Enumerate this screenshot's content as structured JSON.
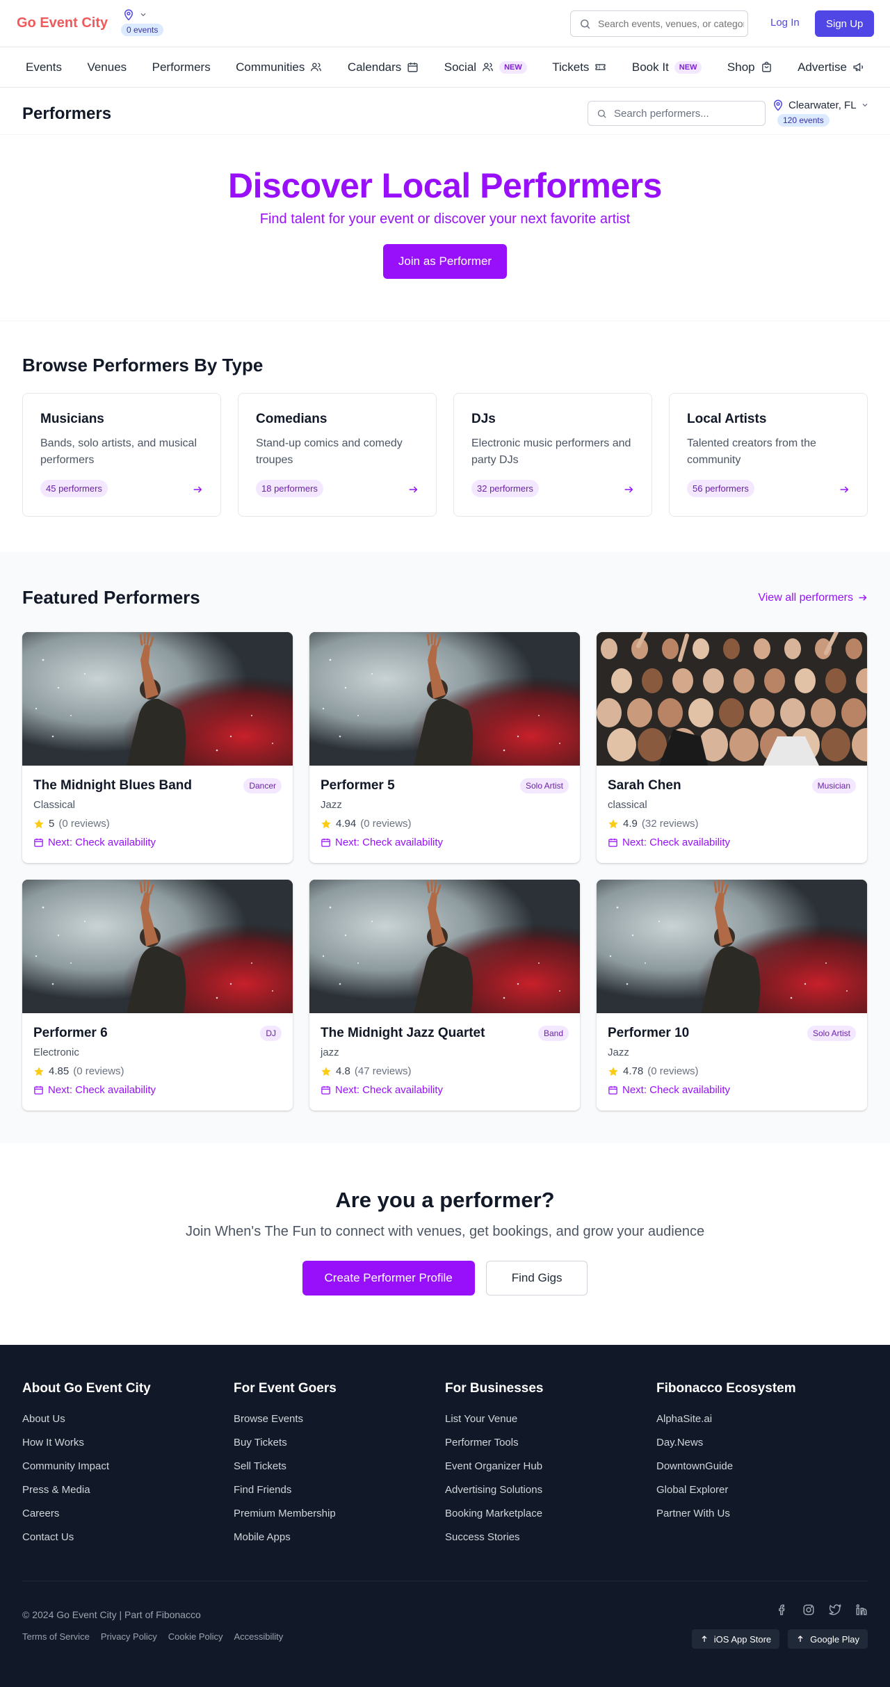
{
  "header": {
    "logo": "Go Event City",
    "location_events": "0 events",
    "search_placeholder": "Search events, venues, or categories...",
    "login": "Log In",
    "signup": "Sign Up"
  },
  "nav": [
    {
      "label": "Events"
    },
    {
      "label": "Venues"
    },
    {
      "label": "Performers"
    },
    {
      "label": "Communities",
      "icon": "users-icon"
    },
    {
      "label": "Calendars",
      "icon": "calendar-icon"
    },
    {
      "label": "Social",
      "icon": "users-icon",
      "badge": "NEW"
    },
    {
      "label": "Tickets",
      "icon": "ticket-icon"
    },
    {
      "label": "Book It",
      "badge": "NEW"
    },
    {
      "label": "Shop",
      "icon": "bag-icon"
    },
    {
      "label": "Advertise",
      "icon": "megaphone-icon"
    }
  ],
  "subheader": {
    "title": "Performers",
    "search_placeholder": "Search performers...",
    "location": "Clearwater, FL",
    "events": "120 events"
  },
  "hero": {
    "title": "Discover Local Performers",
    "subtitle": "Find talent for your event or discover your next favorite artist",
    "button": "Join as Performer"
  },
  "browse": {
    "title": "Browse Performers By Type",
    "types": [
      {
        "name": "Musicians",
        "desc": "Bands, solo artists, and musical performers",
        "count": "45 performers"
      },
      {
        "name": "Comedians",
        "desc": "Stand-up comics and comedy troupes",
        "count": "18 performers"
      },
      {
        "name": "DJs",
        "desc": "Electronic music performers and party DJs",
        "count": "32 performers"
      },
      {
        "name": "Local Artists",
        "desc": "Talented creators from the community",
        "count": "56 performers"
      }
    ]
  },
  "featured": {
    "title": "Featured Performers",
    "view_all": "View all performers",
    "performers": [
      {
        "name": "The Midnight Blues Band",
        "tag": "Dancer",
        "genre": "Classical",
        "rating": "5",
        "reviews": "(0 reviews)",
        "next": "Next: Check availability",
        "image": "concert-smoke"
      },
      {
        "name": "Performer 5",
        "tag": "Solo Artist",
        "genre": "Jazz",
        "rating": "4.94",
        "reviews": "(0 reviews)",
        "next": "Next: Check availability",
        "image": "concert-smoke"
      },
      {
        "name": "Sarah Chen",
        "tag": "Musician",
        "genre": "classical",
        "rating": "4.9",
        "reviews": "(32 reviews)",
        "next": "Next: Check availability",
        "image": "concert-crowd"
      },
      {
        "name": "Performer 6",
        "tag": "DJ",
        "genre": "Electronic",
        "rating": "4.85",
        "reviews": "(0 reviews)",
        "next": "Next: Check availability",
        "image": "concert-smoke"
      },
      {
        "name": "The Midnight Jazz Quartet",
        "tag": "Band",
        "genre": "jazz",
        "rating": "4.8",
        "reviews": "(47 reviews)",
        "next": "Next: Check availability",
        "image": "concert-smoke"
      },
      {
        "name": "Performer 10",
        "tag": "Solo Artist",
        "genre": "Jazz",
        "rating": "4.78",
        "reviews": "(0 reviews)",
        "next": "Next: Check availability",
        "image": "concert-smoke"
      }
    ]
  },
  "cta": {
    "title": "Are you a performer?",
    "subtitle": "Join When's The Fun to connect with venues, get bookings, and grow your audience",
    "primary": "Create Performer Profile",
    "secondary": "Find Gigs"
  },
  "footer": {
    "columns": [
      {
        "title": "About Go Event City",
        "links": [
          "About Us",
          "How It Works",
          "Community Impact",
          "Press & Media",
          "Careers",
          "Contact Us"
        ]
      },
      {
        "title": "For Event Goers",
        "links": [
          "Browse Events",
          "Buy Tickets",
          "Sell Tickets",
          "Find Friends",
          "Premium Membership",
          "Mobile Apps"
        ]
      },
      {
        "title": "For Businesses",
        "links": [
          "List Your Venue",
          "Performer Tools",
          "Event Organizer Hub",
          "Advertising Solutions",
          "Booking Marketplace",
          "Success Stories"
        ]
      },
      {
        "title": "Fibonacco Ecosystem",
        "links": [
          "AlphaSite.ai",
          "Day.News",
          "DowntownGuide",
          "Global Explorer",
          "Partner With Us"
        ]
      }
    ],
    "copyright": "© 2024 Go Event City | Part of Fibonacco",
    "legal": [
      "Terms of Service",
      "Privacy Policy",
      "Cookie Policy",
      "Accessibility"
    ],
    "stores": [
      "iOS App Store",
      "Google Play"
    ]
  },
  "colors": {
    "brand_purple": "#9810fa",
    "indigo": "#4f46e5",
    "logo_red": "#ef5a5a",
    "footer_bg": "#111827",
    "star": "#facc15"
  }
}
